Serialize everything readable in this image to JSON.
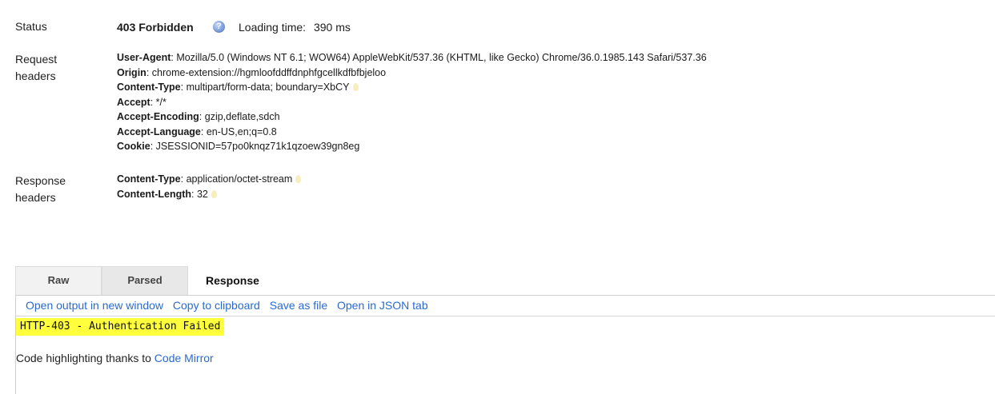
{
  "status": {
    "label": "Status",
    "code": "403 Forbidden",
    "loading_label": "Loading time:",
    "loading_value": "390 ms"
  },
  "request_headers": {
    "label_line1": "Request",
    "label_line2": "headers",
    "items": [
      {
        "name": "User-Agent",
        "value": ": Mozilla/5.0 (Windows NT 6.1; WOW64) AppleWebKit/537.36 (KHTML, like Gecko) Chrome/36.0.1985.143 Safari/537.36"
      },
      {
        "name": "Origin",
        "value": ": chrome-extension://hgmloofddffdnphfgcellkdfbfbjeloo"
      },
      {
        "name": "Content-Type",
        "value": ": multipart/form-data; boundary=XbCY"
      },
      {
        "name": "Accept",
        "value": ": */*"
      },
      {
        "name": "Accept-Encoding",
        "value": ": gzip,deflate,sdch"
      },
      {
        "name": "Accept-Language",
        "value": ": en-US,en;q=0.8"
      },
      {
        "name": "Cookie",
        "value": ": JSESSIONID=57po0knqz71k1qzoew39gn8eg"
      }
    ]
  },
  "response_headers": {
    "label_line1": "Response",
    "label_line2": "headers",
    "items": [
      {
        "name": "Content-Type",
        "value": ": application/octet-stream"
      },
      {
        "name": "Content-Length",
        "value": ": 32"
      }
    ]
  },
  "tabs": {
    "raw": "Raw",
    "parsed": "Parsed",
    "response_title": "Response"
  },
  "toolbar": {
    "open_new_window": "Open output in new window",
    "copy_clipboard": "Copy to clipboard",
    "save_file": "Save as file",
    "open_json": "Open in JSON tab"
  },
  "output": {
    "code_line": "HTTP-403 - Authentication Failed",
    "credit_text": "Code highlighting thanks to ",
    "credit_link": "Code Mirror"
  },
  "colors": {
    "link": "#2a6ad0",
    "highlight": "#ffff3b"
  },
  "icons": {
    "help": "help-icon",
    "hint": "lightbulb-icon"
  }
}
